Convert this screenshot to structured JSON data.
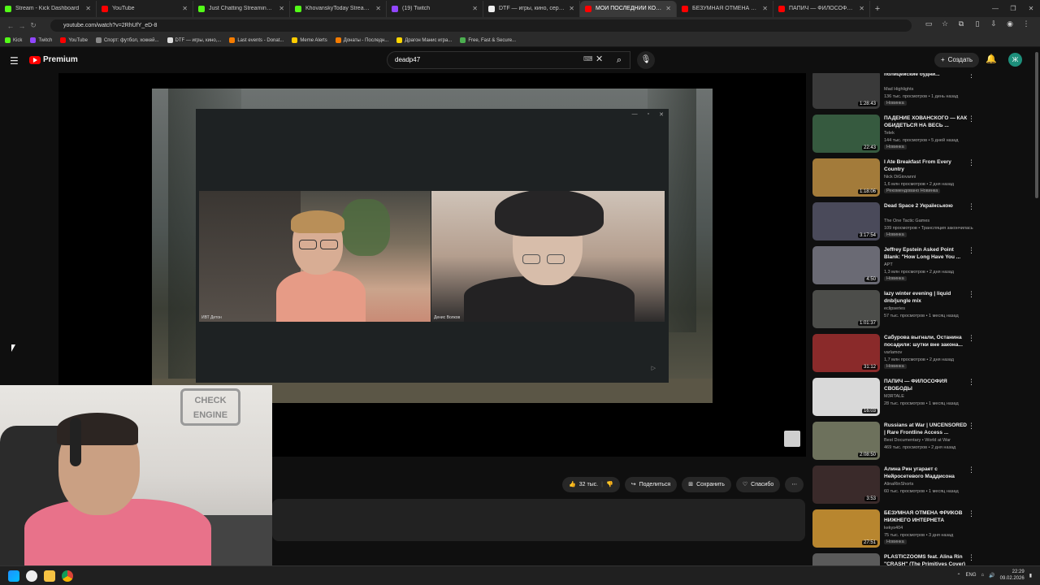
{
  "browser": {
    "tabs": [
      {
        "label": "Stream - Kick Dashboard",
        "color": "#53fc18"
      },
      {
        "label": "YouTube",
        "color": "#ff0000"
      },
      {
        "label": "Just Chatting Streaming - Live",
        "color": "#53fc18"
      },
      {
        "label": "KhovanskyToday Stream - Watch",
        "color": "#53fc18"
      },
      {
        "label": "(19) Twitch",
        "color": "#9146ff"
      },
      {
        "label": "DTF — игры, кино, сериалы, разработка",
        "color": "#eeeeee"
      },
      {
        "label": "МОЙ ПОСЛЕДНИЙ КОНФЛИКТ",
        "color": "#ff0000"
      },
      {
        "label": "БЕЗУМНАЯ ОТМЕНА ФРИКОВ",
        "color": "#ff0000"
      },
      {
        "label": "ПАПИЧ — ФИЛОСОФИЯ СВОБОДЫ",
        "color": "#ff0000"
      }
    ],
    "url": "youtube.com/watch?v=2RhUfY_eD-8",
    "bookmarks": [
      {
        "label": "Kick",
        "color": "#53fc18"
      },
      {
        "label": "Twitch",
        "color": "#9146ff"
      },
      {
        "label": "YouTube",
        "color": "#ff0000"
      },
      {
        "label": "Спорт: футбол, хоккей...",
        "color": "#888888"
      },
      {
        "label": "DTF — игры, кино,...",
        "color": "#dddddd"
      },
      {
        "label": "Last events - Donat...",
        "color": "#f57c00"
      },
      {
        "label": "Meme Alerts",
        "color": "#ffcc00"
      },
      {
        "label": "Донаты - Последн...",
        "color": "#f57c00"
      },
      {
        "label": "Драгон Манис игра...",
        "color": "#ffd600"
      },
      {
        "label": "Free, Fast & Secure...",
        "color": "#4caf50"
      }
    ]
  },
  "youtube": {
    "logo_text": "Premium",
    "search_value": "deadp47",
    "create_label": "Создать",
    "avatar_letter": "Ж"
  },
  "video": {
    "left_cam_label": "ИВТ Детон",
    "right_cam_label": "Денис Волков",
    "like_count": "32 тыс.",
    "share_label": "Поделиться",
    "save_label": "Сохранить",
    "thanks_label": "Спасибо"
  },
  "recommendations": [
    {
      "title": "полицейские будни...",
      "channel": "Mad Highlights",
      "meta": "136 тыс. просмотров • 1 день назад",
      "badge": "Новинка",
      "duration": "1:28:43",
      "thumb": "#3a3a3a"
    },
    {
      "title": "ПАДЕНИЕ ХОВАНСКОГО — КАК ОБИДЕТЬСЯ НА ВЕСЬ ...",
      "channel": "Telek",
      "meta": "144 тыс. просмотров • 5 дней назад",
      "badge": "Новинка",
      "duration": "22:43",
      "thumb": "#365a3f"
    },
    {
      "title": "I Ate Breakfast From Every Country",
      "channel": "Nick DiGiovanni",
      "meta": "1,6 млн просмотров • 2 дня назад",
      "badge": "Рекомендовано  Новинка",
      "duration": "1:18:06",
      "thumb": "#a37b3a"
    },
    {
      "title": "Dead Space 2 Українською",
      "channel": "The One Tactic Games",
      "meta": "109 просмотров • Трансляция закончилась",
      "badge": "Новинка",
      "duration": "3:17:54",
      "thumb": "#4a4a5a"
    },
    {
      "title": "Jeffrey Epstein Asked Point Blank: \"How Long Have You ...",
      "channel": "APT",
      "meta": "1,3 млн просмотров • 2 дня назад",
      "badge": "Новинка",
      "duration": "4:50",
      "thumb": "#6a6a74"
    },
    {
      "title": "lazy winter evening | liquid dnb/jungle mix",
      "channel": "eclipseries",
      "meta": "57 тыс. просмотров • 1 месяц назад",
      "badge": "",
      "duration": "1:01:37",
      "thumb": "#4c4d4a"
    },
    {
      "title": "Сабурова выгнали, Останина посадили: шутки вне закона...",
      "channel": "varlamov",
      "meta": "1,7 млн просмотров • 2 дня назад",
      "badge": "Новинка",
      "duration": "31:12",
      "thumb": "#8a2a2a"
    },
    {
      "title": "ПАПИЧ — ФИЛОСОФИЯ СВОБОДЫ",
      "channel": "M3RTALE",
      "meta": "28 тыс. просмотров • 1 месяц назад",
      "badge": "",
      "duration": "16:03",
      "thumb": "#d9d9d9"
    },
    {
      "title": "Russians at War | UNCENSORED | Rare Frontline Access ...",
      "channel": "Best Documentary • World at War",
      "meta": "469 тыс. просмотров • 2 дня назад",
      "badge": "",
      "duration": "2:08:50",
      "thumb": "#6d715c"
    },
    {
      "title": "Алина Рин угарает с Нейросетевого Маддисона",
      "channel": "AlinaRinShorts",
      "meta": "60 тыс. просмотров • 1 месяц назад",
      "badge": "",
      "duration": "3:53",
      "thumb": "#3a2a2a"
    },
    {
      "title": "БЕЗУМНАЯ ОТМЕНА ФРИКОВ НИЖНЕГО ИНТЕРНЕТА",
      "channel": "kekys404",
      "meta": "75 тыс. просмотров • 3 дня назад",
      "badge": "Новинка",
      "duration": "27:51",
      "thumb": "#b8862f"
    },
    {
      "title": "PLASTICZOOMS feat. Alina Rin \"CRASH\" (The Primitives Cover)",
      "channel": "Alina Rin",
      "meta": "1 млн просмотров • 11 лет назад",
      "badge": "",
      "duration": "3:28",
      "thumb": "#5a5a5a"
    }
  ],
  "taskbar": {
    "lang": "ENG",
    "time": "22:29",
    "date": "09.02.2026"
  }
}
